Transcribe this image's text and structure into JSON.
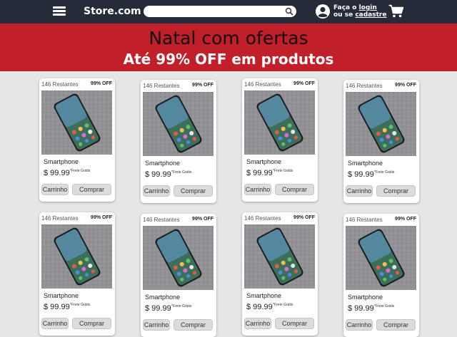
{
  "header": {
    "logo": "Store.com",
    "search": {
      "value": "",
      "placeholder": ""
    },
    "login": {
      "prefix": "Faça o",
      "login_link": "login",
      "middle": "ou se",
      "signup_link": "cadastre"
    }
  },
  "banner": {
    "title": "Natal com ofertas",
    "subtitle": "Até 99% OFF em produtos"
  },
  "products": [
    {
      "stock": "146 Restantes",
      "discount": "99% OFF",
      "name": "Smartphone",
      "price": "$ 99.99",
      "shipping": "*Frete Grátis",
      "cart_label": "Carrinho",
      "buy_label": "Comprar"
    },
    {
      "stock": "146 Restantes",
      "discount": "99% OFF",
      "name": "Smartphone",
      "price": "$ 99.99",
      "shipping": "*Frete Grátis",
      "cart_label": "Carrinho",
      "buy_label": "Comprar"
    },
    {
      "stock": "146 Restantes",
      "discount": "99% OFF",
      "name": "Smartphone",
      "price": "$ 99.99",
      "shipping": "*Frete Grátis",
      "cart_label": "Carrinho",
      "buy_label": "Comprar"
    },
    {
      "stock": "146 Restantes",
      "discount": "99% OFF",
      "name": "Smartphone",
      "price": "$ 99.99",
      "shipping": "*Frete Grátis",
      "cart_label": "Carrinho",
      "buy_label": "Comprar"
    },
    {
      "stock": "146 Restantes",
      "discount": "99% OFF",
      "name": "Smartphone",
      "price": "$ 99.99",
      "shipping": "*Frete Grátis",
      "cart_label": "Carrinho",
      "buy_label": "Comprar"
    },
    {
      "stock": "146 Restantes",
      "discount": "99% OFF",
      "name": "Smartphone",
      "price": "$ 99.99",
      "shipping": "*Frete Grátis",
      "cart_label": "Carrinho",
      "buy_label": "Comprar"
    },
    {
      "stock": "146 Restantes",
      "discount": "99% OFF",
      "name": "Smartphone",
      "price": "$ 99.99",
      "shipping": "*Frete Grátis",
      "cart_label": "Carrinho",
      "buy_label": "Comprar"
    },
    {
      "stock": "146 Restantes",
      "discount": "99% OFF",
      "name": "Smartphone",
      "price": "$ 99.99",
      "shipping": "*Frete Grátis",
      "cart_label": "Carrinho",
      "buy_label": "Comprar"
    }
  ],
  "icons": {
    "menu": "hamburger-menu-icon",
    "search": "search-icon",
    "user": "user-avatar-icon",
    "cart": "shopping-cart-icon"
  },
  "colors": {
    "header_bg": "#262b3a",
    "banner_bg": "#c11f29",
    "page_bg": "#e6e6e6"
  }
}
